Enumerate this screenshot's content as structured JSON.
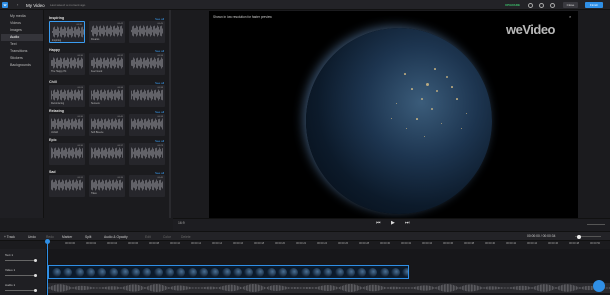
{
  "topbar": {
    "back_icon": "‹",
    "title": "My Video",
    "saved": "Last saved: a moment ago",
    "upgrade": "UPGRADE",
    "close_label": "Close",
    "finish_label": "Finish"
  },
  "sidebar": {
    "items": [
      {
        "label": "My media",
        "icon": "folder-icon"
      },
      {
        "label": "Videos",
        "icon": "video-icon"
      },
      {
        "label": "Images",
        "icon": "image-icon"
      },
      {
        "label": "Audio",
        "icon": "music-icon",
        "active": true
      },
      {
        "label": "Text",
        "icon": "text-icon"
      },
      {
        "label": "Transitions",
        "icon": "transition-icon"
      },
      {
        "label": "Stickers",
        "icon": "sticker-icon"
      },
      {
        "label": "Backgrounds",
        "icon": "background-icon"
      }
    ]
  },
  "library": {
    "see_all": "See all",
    "categories": [
      {
        "title": "Inspiring",
        "tracks": [
          {
            "name": "Inspiring",
            "dur": "00:30"
          },
          {
            "name": "Dreams",
            "dur": "00:42"
          },
          {
            "name": "",
            "dur": "00:45"
          }
        ]
      },
      {
        "title": "Happy",
        "tracks": [
          {
            "name": "The Happy Hit",
            "dur": "00:30"
          },
          {
            "name": "Feel Good",
            "dur": "00:32"
          },
          {
            "name": "",
            "dur": "00:34"
          }
        ]
      },
      {
        "title": "Chill",
        "tracks": [
          {
            "name": "Reminiscing",
            "dur": "00:26"
          },
          {
            "name": "Sunsets",
            "dur": "00:36"
          },
          {
            "name": "",
            "dur": "00:38"
          }
        ]
      },
      {
        "title": "Relaxing",
        "tracks": [
          {
            "name": "Unfold",
            "dur": "00:30"
          },
          {
            "name": "Soft Breeze",
            "dur": "00:40"
          },
          {
            "name": "",
            "dur": "00:33"
          }
        ]
      },
      {
        "title": "Epic",
        "tracks": [
          {
            "name": "",
            "dur": "00:30"
          },
          {
            "name": "",
            "dur": "00:37"
          },
          {
            "name": "",
            "dur": "00:29"
          }
        ]
      },
      {
        "title": "Sad",
        "tracks": [
          {
            "name": "",
            "dur": "00:31"
          },
          {
            "name": "Tides",
            "dur": "00:35"
          },
          {
            "name": "",
            "dur": "00:40"
          }
        ]
      }
    ]
  },
  "preview": {
    "note": "Shown in low resolution for faster preview",
    "watermark": "weVideo",
    "close_icon": "×"
  },
  "controls": {
    "ratio": "16:9",
    "prev_icon": "⏮",
    "play_icon": "▶",
    "next_icon": "⏭"
  },
  "timeline_toolbar": {
    "tools": [
      {
        "label": "+ Track",
        "enabled": true
      },
      {
        "label": "Undo",
        "enabled": true
      },
      {
        "label": "Redo",
        "enabled": false
      },
      {
        "label": "Marker",
        "enabled": true
      },
      {
        "label": "Split",
        "enabled": true
      },
      {
        "label": "Audio & Opacity",
        "enabled": true
      },
      {
        "label": "Edit",
        "enabled": false
      },
      {
        "label": "Color",
        "enabled": false
      },
      {
        "label": "Delete",
        "enabled": false
      }
    ],
    "timecode": "00:00:00 / 00:00:34"
  },
  "ruler": {
    "ticks": [
      "00:00:00",
      "00:00:02",
      "00:00:04",
      "00:00:06",
      "00:00:08",
      "00:00:10",
      "00:00:12",
      "00:00:14",
      "00:00:16",
      "00:00:18",
      "00:00:20",
      "00:00:22",
      "00:00:24",
      "00:00:26",
      "00:00:28",
      "00:00:30",
      "00:00:32",
      "00:00:34",
      "00:00:36",
      "00:00:38",
      "00:00:40",
      "00:00:42",
      "00:00:44",
      "00:00:46",
      "00:00:48",
      "00:00:50"
    ]
  },
  "tracks": [
    {
      "label": "Text 1"
    },
    {
      "label": "Video 1"
    },
    {
      "label": "Audio 1"
    }
  ],
  "colors": {
    "accent": "#2f8fe6",
    "upgrade": "#3ec46d",
    "bg": "#1b1b1e"
  }
}
